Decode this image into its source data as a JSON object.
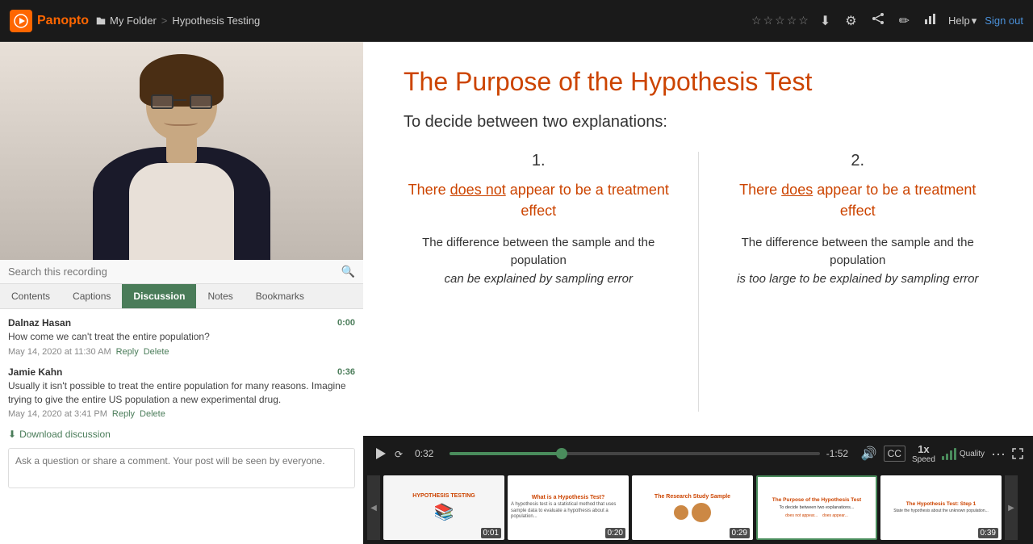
{
  "app": {
    "name": "Panopto"
  },
  "topbar": {
    "breadcrumb": {
      "folder_label": "My Folder",
      "separator": ">",
      "current": "Hypothesis Testing"
    },
    "actions": {
      "help_label": "Help",
      "signout_label": "Sign out"
    },
    "stars": [
      "☆",
      "☆",
      "☆",
      "☆",
      "☆"
    ]
  },
  "sidebar": {
    "search_placeholder": "Search this recording",
    "tabs": [
      "Contents",
      "Captions",
      "Discussion",
      "Notes",
      "Bookmarks"
    ],
    "active_tab": "Discussion",
    "comments": [
      {
        "author": "Dalnaz Hasan",
        "timestamp": "0:00",
        "text": "How come we can't treat the entire population?",
        "date": "May 14, 2020 at 11:30 AM",
        "actions": [
          "Reply",
          "Delete"
        ]
      },
      {
        "author": "Jamie Kahn",
        "timestamp": "0:36",
        "text": "Usually it isn't possible to treat the entire population for many reasons. Imagine trying to give the entire US population a new experimental drug.",
        "date": "May 14, 2020 at 3:41 PM",
        "actions": [
          "Reply",
          "Delete"
        ]
      }
    ],
    "download_label": "Download discussion",
    "comment_placeholder": "Ask a question or share a comment. Your post will be seen by everyone."
  },
  "slide": {
    "title": "The Purpose of the Hypothesis Test",
    "subtitle": "To decide between two explanations:",
    "col1": {
      "number": "1.",
      "heading_pre": "There ",
      "heading_underline": "does not",
      "heading_post": " appear to be a treatment effect",
      "body": "The difference between the sample and the population",
      "body_italic": "can be explained by sampling error"
    },
    "col2": {
      "number": "2.",
      "heading_pre": "There ",
      "heading_underline": "does",
      "heading_post": " appear to be a treatment effect",
      "body": "The difference between the sample and the population",
      "body_italic": "is too large to be explained by sampling error"
    }
  },
  "player": {
    "current_time": "0:32",
    "remaining_time": "-1:52",
    "progress_percent": 30.4,
    "speed": "1x",
    "speed_label": "Speed",
    "quality_label": "Quality"
  },
  "thumbnails": [
    {
      "title": "HYPOTHESIS TESTING",
      "time": "0:01",
      "active": false
    },
    {
      "title": "What is a Hypothesis Test?",
      "time": "0:20",
      "active": false
    },
    {
      "title": "The Research Study Sample",
      "time": "0:29",
      "active": false
    },
    {
      "title": "The Purpose of the Hypothesis Test",
      "time": "",
      "active": true
    },
    {
      "title": "The Hypothesis Test: Step 1",
      "time": "0:39",
      "active": false
    }
  ]
}
